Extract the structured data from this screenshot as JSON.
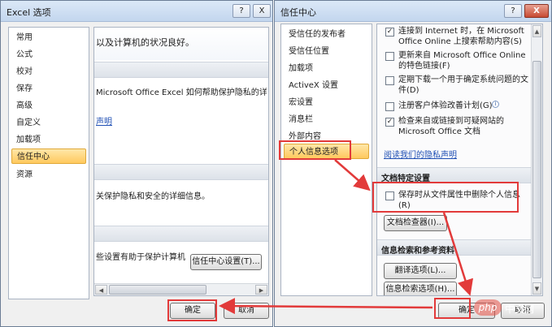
{
  "excel_options": {
    "title": "Excel 选项",
    "help_label": "?",
    "close_label": "X",
    "nav": [
      "常用",
      "公式",
      "校对",
      "保存",
      "高级",
      "自定义",
      "加载项",
      "信任中心",
      "资源"
    ],
    "active_index": 7,
    "content": {
      "line1": "以及计算机的状况良好。",
      "line2": "Microsoft Office Excel 如何帮助保护隐私的详",
      "link1": "声明",
      "line3": "关保护隐私和安全的详细信息。",
      "line4": "些设置有助于保护计算机",
      "settings_button": "信任中心设置(T)..."
    },
    "ok_label": "确定",
    "cancel_label": "取消"
  },
  "trust_center": {
    "title": "信任中心",
    "help_label": "?",
    "close_label": "X",
    "nav": [
      "受信任的发布者",
      "受信任位置",
      "加载项",
      "ActiveX 设置",
      "宏设置",
      "消息栏",
      "外部内容",
      "个人信息选项"
    ],
    "active_index": 7,
    "options": [
      {
        "label": "连接到 Internet 时，在 Microsoft\nOffice Online 上搜索帮助内容(S)",
        "checked": true
      },
      {
        "label": "更新来自 Microsoft Office Online\n的特色链接(F)",
        "checked": false
      },
      {
        "label": "定期下载一个用于确定系统问题的文\n件(D)",
        "checked": false
      },
      {
        "label": "注册客户体验改善计划(G)",
        "checked": false
      },
      {
        "label": "检查来自或链接到可疑网站的\nMicrosoft Office 文档",
        "checked": true
      }
    ],
    "privacy_link": "阅读我们的隐私声明",
    "doc_section_title": "文档特定设置",
    "remove_personal": {
      "label": "保存时从文件属性中删除个人信息\n(R)",
      "checked": false
    },
    "doc_inspector_button": "文档检查器(I)...",
    "research_section_title": "信息检索和参考资料",
    "translate_button": "翻译选项(L)...",
    "research_button": "信息检索选项(H)...",
    "ok_label": "确定",
    "cancel_label": "取消"
  },
  "watermark": {
    "logo": "php",
    "text": "中文网"
  },
  "colors": {
    "highlight_red": "#e23a3a",
    "nav_active": "#ffc95e",
    "link_blue": "#1f4fb4"
  },
  "icons": {
    "info": "info-icon",
    "scroll_up": "▲",
    "scroll_down": "▼",
    "scroll_left": "◀",
    "scroll_right": "▶",
    "check": "✓"
  }
}
